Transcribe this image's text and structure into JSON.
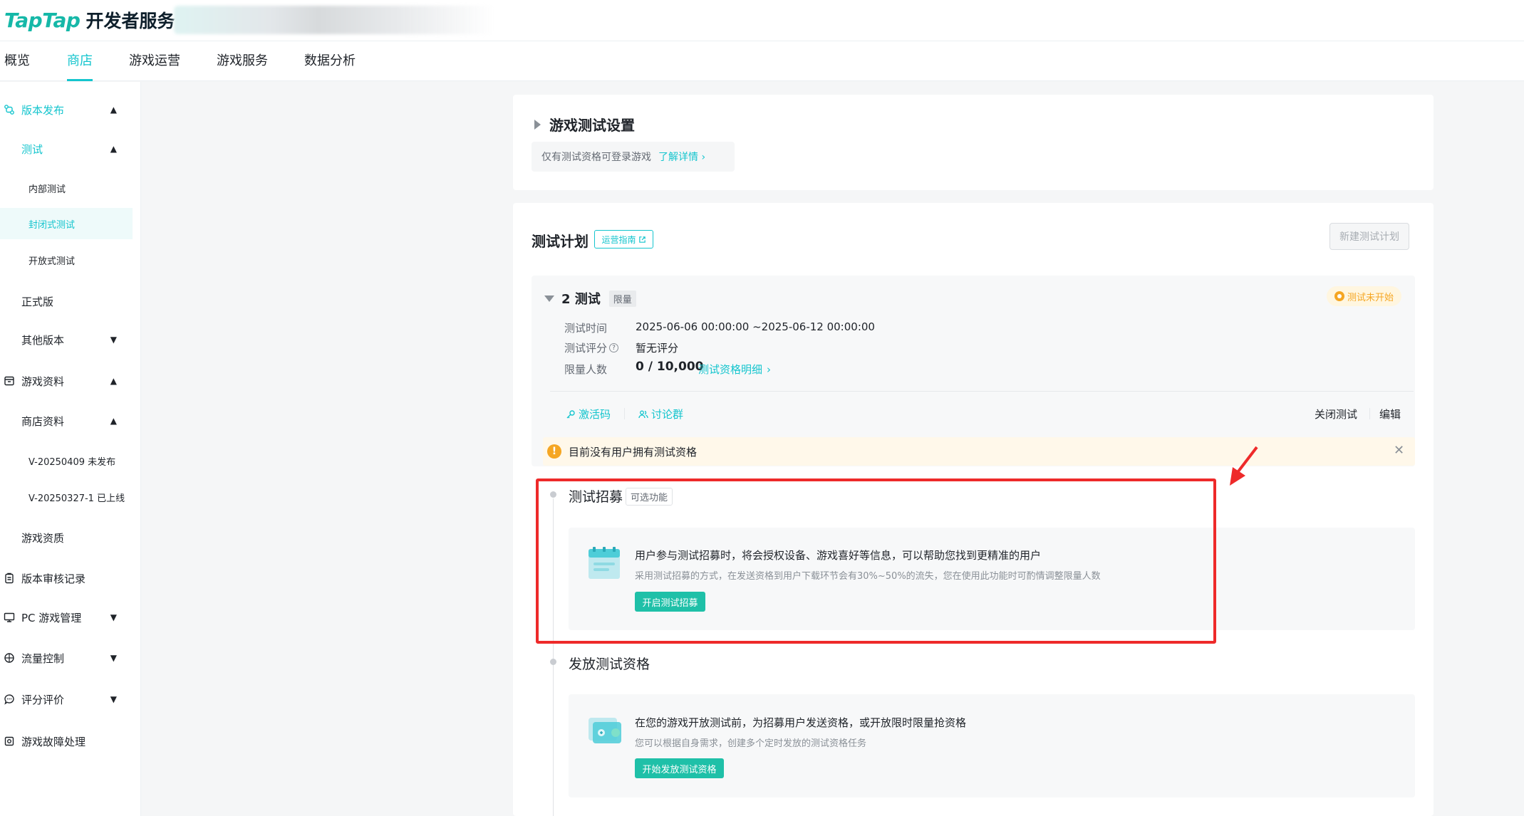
{
  "header": {
    "brand": "TapTap",
    "subtitle": "开发者服务"
  },
  "nav": {
    "tabs": [
      {
        "label": "概览"
      },
      {
        "label": "商店",
        "active": true
      },
      {
        "label": "游戏运营"
      },
      {
        "label": "游戏服务"
      },
      {
        "label": "数据分析"
      }
    ]
  },
  "sidebar": {
    "release": "版本发布",
    "test": "测试",
    "internal_test": "内部测试",
    "closed_test": "封闭式测试",
    "open_test": "开放式测试",
    "official": "正式版",
    "other_versions": "其他版本",
    "game_info": "游戏资料",
    "store_info": "商店资料",
    "version_1": "V-20250409 未发布",
    "version_2": "V-20250327-1 已上线",
    "game_qualification": "游戏资质",
    "review_record": "版本审核记录",
    "pc_manage": "PC 游戏管理",
    "traffic": "流量控制",
    "rating": "评分评价",
    "fault": "游戏故障处理"
  },
  "settings": {
    "title": "游戏测试设置",
    "note": "仅有测试资格可登录游戏",
    "note_link": "了解详情"
  },
  "plan": {
    "title": "测试计划",
    "guide": "运营指南",
    "new_button": "新建测试计划",
    "name": "2 测试",
    "limit_tag": "限量",
    "status": "测试未开始",
    "labels": {
      "time": "测试时间",
      "score": "测试评分",
      "limit": "限量人数"
    },
    "values": {
      "time": "2025-06-06 00:00:00 ~2025-06-12 00:00:00",
      "score": "暂无评分",
      "limit": "0 / 10,000"
    },
    "detail_link": "测试资格明细",
    "activation_code": "激活码",
    "discussion_group": "讨论群",
    "close_test": "关闭测试",
    "edit": "编辑",
    "warning": "目前没有用户拥有测试资格"
  },
  "recruit": {
    "title": "测试招募",
    "optional": "可选功能",
    "main": "用户参与测试招募时，将会授权设备、游戏喜好等信息，可以帮助您找到更精准的用户",
    "sub": "采用测试招募的方式，在发送资格到用户下载环节会有30%~50%的流失，您在使用此功能时可酌情调整限量人数",
    "button": "开启测试招募"
  },
  "issue": {
    "title": "发放测试资格",
    "main": "在您的游戏开放测试前，为招募用户发送资格，或开放限时限量抢资格",
    "sub": "您可以根据自身需求，创建多个定时发放的测试资格任务",
    "button": "开始发放测试资格"
  },
  "colors": {
    "accent": "#15c5ce",
    "button": "#1fc0a8",
    "warning": "#f5a623",
    "highlight": "#ee2a2a"
  }
}
